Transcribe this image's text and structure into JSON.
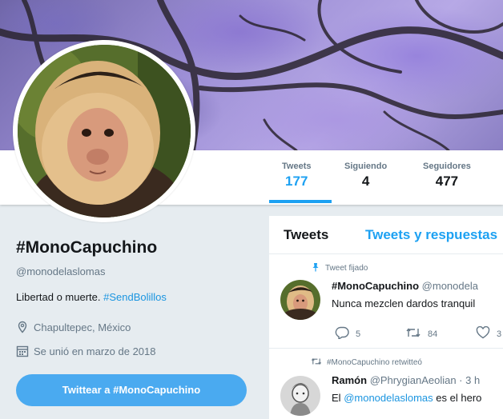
{
  "stats": [
    {
      "label": "Tweets",
      "value": "177"
    },
    {
      "label": "Siguiendo",
      "value": "4"
    },
    {
      "label": "Seguidores",
      "value": "477"
    }
  ],
  "profile": {
    "name": "#MonoCapuchino",
    "handle": "@monodelaslomas",
    "bio_text": "Libertad o muerte.",
    "bio_hashtag": "#SendBolillos",
    "location": "Chapultepec, México",
    "joined": "Se unió en marzo de 2018",
    "tweet_button": "Twittear a #MonoCapuchino"
  },
  "timeline": {
    "tabs": [
      "Tweets",
      "Tweets y respuestas"
    ],
    "pinned": {
      "context": "Tweet fijado",
      "name": "#MonoCapuchino",
      "handle": "@monodela",
      "text": "Nunca mezclen dardos tranquil",
      "replies": "5",
      "retweets": "84",
      "likes": "3"
    },
    "retweet": {
      "context": "#MonoCapuchino retwitteó",
      "name": "Ramón",
      "handle_time": "@PhrygianAeolian · 3 h",
      "text_prefix": "El",
      "mention": "@monodelaslomas",
      "text_suffix": "es el hero"
    }
  },
  "colors": {
    "accent": "#1da1f2",
    "link": "#1b95e0",
    "button": "#4aaaf0",
    "background": "#e6ecf0",
    "muted": "#657786"
  },
  "icons": [
    "pin-icon",
    "location-icon",
    "calendar-icon",
    "retweet-icon",
    "reply-icon",
    "heart-icon"
  ]
}
